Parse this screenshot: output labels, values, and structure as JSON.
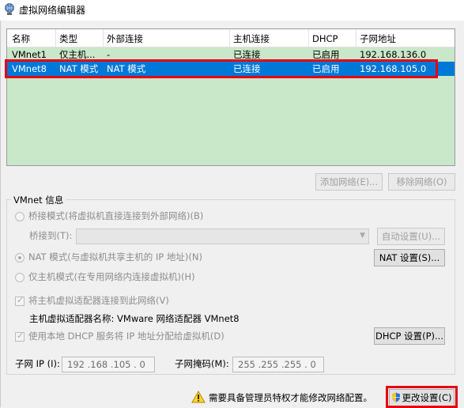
{
  "window": {
    "title": "虚拟网络编辑器"
  },
  "columns": [
    "名称",
    "类型",
    "外部连接",
    "主机连接",
    "DHCP",
    "子网地址"
  ],
  "rows": [
    {
      "name": "VMnet1",
      "type": "仅主机...",
      "external": "-",
      "host": "已连接",
      "dhcp": "已启用",
      "subnet": "192.168.136.0"
    },
    {
      "name": "VMnet8",
      "type": "NAT 模式",
      "external": "NAT 模式",
      "host": "已连接",
      "dhcp": "已启用",
      "subnet": "192.168.105.0"
    }
  ],
  "buttons": {
    "add_network": "添加网络(E)...",
    "remove_network": "移除网络(O)",
    "auto_settings": "自动设置(U)...",
    "nat_settings": "NAT 设置(S)...",
    "dhcp_settings": "DHCP 设置(P)...",
    "change_settings": "更改设置(C)"
  },
  "info": {
    "group_title": "VMnet 信息",
    "bridged_mode": "桥接模式(将虚拟机直接连接到外部网络)(B)",
    "bridged_to_label": "桥接到(T):",
    "bridged_to_value": "",
    "nat_mode": "NAT 模式(与虚拟机共享主机的 IP 地址)(N)",
    "host_only_mode": "仅主机模式(在专用网络内连接虚拟机)(H)",
    "connect_adapter": "将主机虚拟适配器连接到此网络(V)",
    "adapter_name_label": "主机虚拟适配器名称: VMware 网络适配器 VMnet8",
    "use_dhcp": "使用本地 DHCP 服务将 IP 地址分配给虚拟机(D)",
    "subnet_ip_label": "子网 IP (I):",
    "subnet_ip_value": "192 .168 .105 .  0",
    "subnet_mask_label": "子网掩码(M):",
    "subnet_mask_value": "255 .255 .255 .  0"
  },
  "footer": {
    "admin_warning": "需要具备管理员特权才能修改网络配置。"
  },
  "colors": {
    "selection": "#0078d7",
    "list_bg": "#c9e7c9",
    "highlight": "#e60012"
  }
}
